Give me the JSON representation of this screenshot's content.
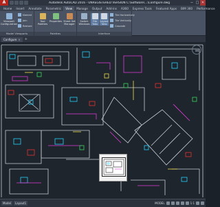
{
  "titlebar": {
    "app_letter": "A",
    "title": "Autodesk AutoCAD 2016 - UNREGISTERED VERSION    C:\\Software\\...\\Configure.dwg",
    "minimize": "─",
    "maximize": "□",
    "close": "✕"
  },
  "ribbon_tabs": [
    "Home",
    "Insert",
    "Annotate",
    "Parametric",
    "View",
    "Manage",
    "Output",
    "Add-ins",
    "A360",
    "Express Tools",
    "Featured Apps",
    "BIM 360",
    "Performance"
  ],
  "active_tab": "View",
  "ribbon": {
    "viewport": {
      "label": "Model Viewports",
      "button": "Viewport Configuration",
      "small": [
        "Named",
        "Join",
        "Restore"
      ]
    },
    "palettes": {
      "label": "Palettes",
      "buttons": [
        "Tool Palettes",
        "Properties",
        "Sheet Set Manager"
      ]
    },
    "interface": {
      "label": "Interface",
      "buttons": [
        "Switch Windows",
        "File Tabs",
        "Layout Tabs"
      ],
      "small": [
        "Tile Horizontally",
        "Tile Vertically",
        "Cascade"
      ]
    }
  },
  "document_tabs": {
    "active": "Configure",
    "close": "×",
    "plus": "+"
  },
  "status": {
    "model_tab": "Model",
    "layout_tab": "Layout1",
    "mode": "MODEL",
    "scale": "1:1"
  },
  "colors": {
    "canvas": "#1e252d",
    "walls": "#c8ccd2",
    "cyan": "#25d4ff",
    "magenta": "#e23bd9",
    "red": "#e8332b",
    "yellow": "#f2e14b",
    "green": "#36d65a",
    "blue": "#3b6bff"
  }
}
